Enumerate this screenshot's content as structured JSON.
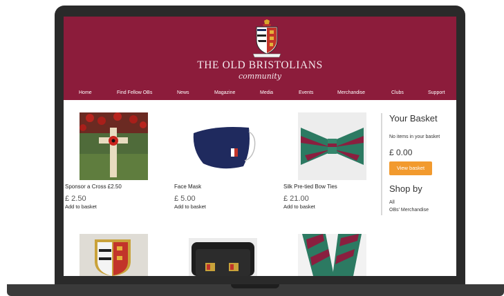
{
  "brand": {
    "title": "THE OLD BRISTOLIANS",
    "subtitle": "community",
    "crest_motto": "IN HONOR OF LOVE"
  },
  "nav": [
    "Home",
    "Find Fellow OBs",
    "News",
    "Magazine",
    "Media",
    "Events",
    "Merchandise",
    "Clubs",
    "Support"
  ],
  "products": [
    {
      "name": "Sponsor a Cross £2.50",
      "price": "£ 2.50",
      "action": "Add to basket"
    },
    {
      "name": "Face Mask",
      "price": "£ 5.00",
      "action": "Add to basket"
    },
    {
      "name": "Silk Pre-tied Bow Ties",
      "price": "£ 21.00",
      "action": "Add to basket"
    }
  ],
  "basket": {
    "title": "Your Basket",
    "empty_text": "No items in your basket",
    "total": "£ 0.00",
    "view_label": "View basket"
  },
  "shop_by": {
    "title": "Shop by",
    "items": [
      "All",
      "OBs' Merchandise"
    ]
  },
  "colors": {
    "header_bg": "#8c1c3b",
    "button_bg": "#f29a2e",
    "laptop_frame": "#2a2a2a"
  }
}
